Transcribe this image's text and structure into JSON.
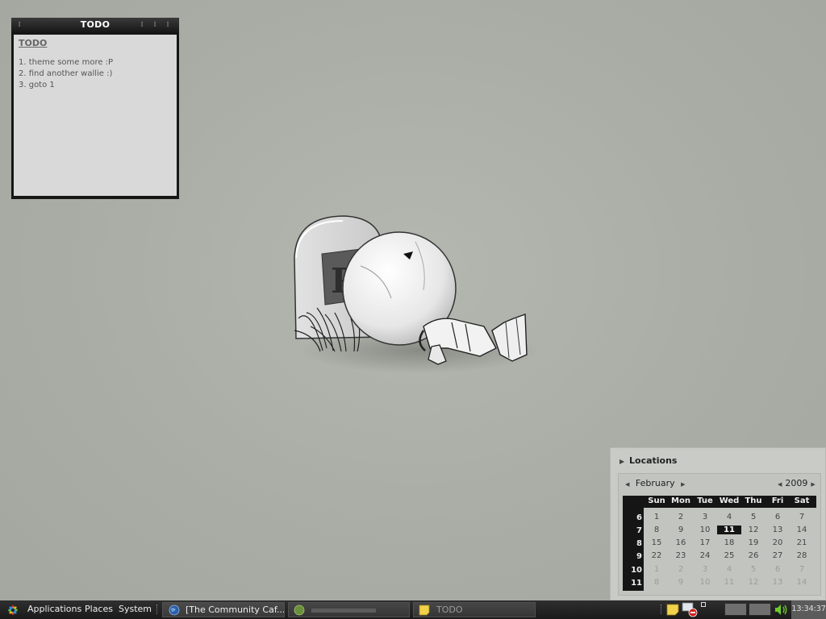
{
  "note": {
    "window_title": "TODO",
    "heading": "TODO",
    "items": [
      "1. theme some more :P",
      "2. find another wallie :)",
      "3. goto 1"
    ]
  },
  "calendar": {
    "locations_label": "Locations",
    "month": "February",
    "year": "2009",
    "day_headers": [
      "Sun",
      "Mon",
      "Tue",
      "Wed",
      "Thu",
      "Fri",
      "Sat"
    ],
    "weeks": [
      {
        "week": "6",
        "days": [
          "1",
          "2",
          "3",
          "4",
          "5",
          "6",
          "7"
        ],
        "other": [
          false,
          false,
          false,
          false,
          false,
          false,
          false
        ]
      },
      {
        "week": "7",
        "days": [
          "8",
          "9",
          "10",
          "11",
          "12",
          "13",
          "14"
        ],
        "other": [
          false,
          false,
          false,
          false,
          false,
          false,
          false
        ]
      },
      {
        "week": "8",
        "days": [
          "15",
          "16",
          "17",
          "18",
          "19",
          "20",
          "21"
        ],
        "other": [
          false,
          false,
          false,
          false,
          false,
          false,
          false
        ]
      },
      {
        "week": "9",
        "days": [
          "22",
          "23",
          "24",
          "25",
          "26",
          "27",
          "28"
        ],
        "other": [
          false,
          false,
          false,
          false,
          false,
          false,
          false
        ]
      },
      {
        "week": "10",
        "days": [
          "1",
          "2",
          "3",
          "4",
          "5",
          "6",
          "7"
        ],
        "other": [
          true,
          true,
          true,
          true,
          true,
          true,
          true
        ]
      },
      {
        "week": "11",
        "days": [
          "8",
          "9",
          "10",
          "11",
          "12",
          "13",
          "14"
        ],
        "other": [
          true,
          true,
          true,
          true,
          true,
          true,
          true
        ]
      }
    ],
    "today": "11"
  },
  "taskbar": {
    "menus": [
      "Applications",
      "Places",
      "System"
    ],
    "tasks": [
      {
        "label": "[The Community Caf...",
        "icon": "globe-icon",
        "active": true
      },
      {
        "label": "",
        "icon": "green-circle-icon",
        "active": false
      },
      {
        "label": "TODO",
        "icon": "sticky-note-icon",
        "active": false
      }
    ],
    "clock": "13:34:37"
  },
  "colors": {
    "desktop_bg": "#a9ada5",
    "accent_volume": "#6ecb2a"
  }
}
